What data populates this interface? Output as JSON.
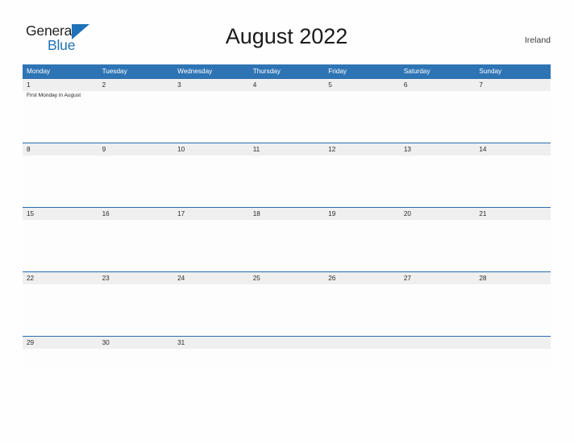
{
  "brand": {
    "line1": "General",
    "line2": "Blue",
    "flag_icon": "blue-triangle-flag-icon",
    "accent_color": "#1f72b8"
  },
  "header": {
    "title": "August 2022",
    "location": "Ireland"
  },
  "colors": {
    "header_blue": "#2e74b5",
    "row_border_blue": "#2a6ca8",
    "date_band_gray": "#efefef",
    "page_background": "#fefefe",
    "text_dark": "#1a1a1a",
    "weekday_text": "#ffffff"
  },
  "calendar": {
    "month": "August",
    "year": "2022",
    "weekday_headers": [
      "Monday",
      "Tuesday",
      "Wednesday",
      "Thursday",
      "Friday",
      "Saturday",
      "Sunday"
    ],
    "weeks": [
      {
        "dates": [
          "1",
          "2",
          "3",
          "4",
          "5",
          "6",
          "7"
        ],
        "events": [
          [
            "First Monday in August"
          ],
          [],
          [],
          [],
          [],
          [],
          []
        ]
      },
      {
        "dates": [
          "8",
          "9",
          "10",
          "11",
          "12",
          "13",
          "14"
        ],
        "events": [
          [],
          [],
          [],
          [],
          [],
          [],
          []
        ]
      },
      {
        "dates": [
          "15",
          "16",
          "17",
          "18",
          "19",
          "20",
          "21"
        ],
        "events": [
          [],
          [],
          [],
          [],
          [],
          [],
          []
        ]
      },
      {
        "dates": [
          "22",
          "23",
          "24",
          "25",
          "26",
          "27",
          "28"
        ],
        "events": [
          [],
          [],
          [],
          [],
          [],
          [],
          []
        ]
      },
      {
        "dates": [
          "29",
          "30",
          "31",
          "",
          "",
          "",
          ""
        ],
        "events": [
          [],
          [],
          [],
          [],
          [],
          [],
          []
        ]
      }
    ]
  }
}
